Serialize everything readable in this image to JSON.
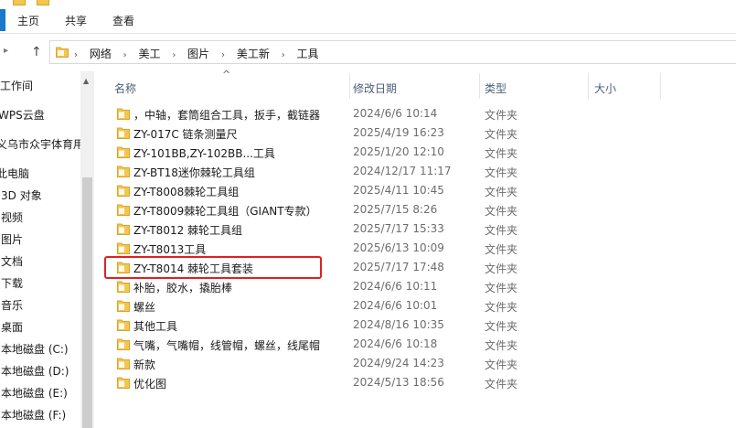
{
  "ribbon": {
    "tabs": [
      "主页",
      "共享",
      "查看"
    ]
  },
  "address": {
    "crumbs": [
      "网络",
      "美工",
      "图片",
      "美工新",
      "工具"
    ]
  },
  "sidebar": {
    "items": [
      "工作间",
      "WPS云盘",
      "义乌市众宇体育用",
      "此电脑",
      "3D 对象",
      "视频",
      "图片",
      "文档",
      "下载",
      "音乐",
      "桌面",
      "本地磁盘 (C:)",
      "本地磁盘 (D:)",
      "本地磁盘 (E:)",
      "本地磁盘 (F:)"
    ]
  },
  "columns": {
    "name": "名称",
    "date": "修改日期",
    "type": "类型",
    "size": "大小"
  },
  "files": [
    {
      "name": "，中轴，套筒组合工具，扳手，截链器",
      "date": "2024/6/6 10:14",
      "type": "文件夹"
    },
    {
      "name": "ZY-017C  链条测量尺",
      "date": "2025/4/19 16:23",
      "type": "文件夹"
    },
    {
      "name": "ZY-101BB,ZY-102BB...工具",
      "date": "2025/1/20 12:10",
      "type": "文件夹"
    },
    {
      "name": "ZY-BT18迷你棘轮工具组",
      "date": "2024/12/17 11:17",
      "type": "文件夹"
    },
    {
      "name": "ZY-T8008棘轮工具组",
      "date": "2025/4/11 10:45",
      "type": "文件夹"
    },
    {
      "name": "ZY-T8009棘轮工具组（GIANT专款）",
      "date": "2025/7/15 8:26",
      "type": "文件夹"
    },
    {
      "name": "ZY-T8012 棘轮工具组",
      "date": "2025/7/17 15:33",
      "type": "文件夹"
    },
    {
      "name": "ZY-T8013工具",
      "date": "2025/6/13 10:09",
      "type": "文件夹"
    },
    {
      "name": "ZY-T8014 棘轮工具套装",
      "date": "2025/7/17 17:48",
      "type": "文件夹"
    },
    {
      "name": "补胎，胶水，撬胎棒",
      "date": "2024/6/6 10:11",
      "type": "文件夹"
    },
    {
      "name": "螺丝",
      "date": "2024/6/6 10:01",
      "type": "文件夹"
    },
    {
      "name": "其他工具",
      "date": "2024/8/16 10:35",
      "type": "文件夹"
    },
    {
      "name": "气嘴，气嘴帽，线管帽，螺丝，线尾帽",
      "date": "2024/6/6 10:18",
      "type": "文件夹"
    },
    {
      "name": "新款",
      "date": "2024/9/24 14:23",
      "type": "文件夹"
    },
    {
      "name": "优化图",
      "date": "2024/5/13 18:56",
      "type": "文件夹"
    }
  ],
  "icons": {
    "folder": "folder-icon",
    "up": "up-arrow-icon"
  },
  "colors": {
    "folder": "#f4c54f",
    "accent": "#1979ca",
    "highlight": "#e02020"
  }
}
